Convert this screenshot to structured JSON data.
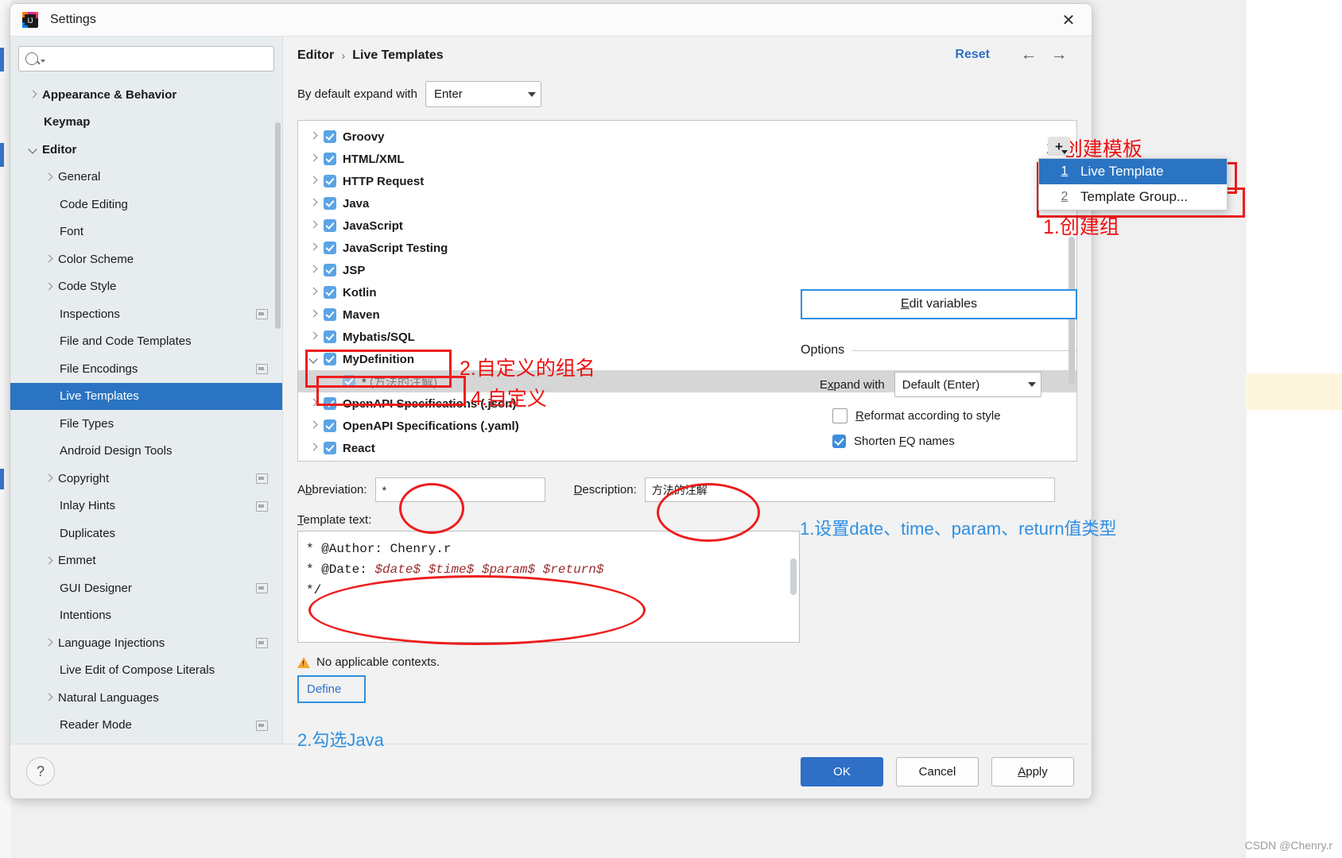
{
  "window": {
    "title": "Settings",
    "app_icon": "intellij-idea-icon",
    "close_label": "✕"
  },
  "sidebar": {
    "search_placeholder": "",
    "search_value": "",
    "items": [
      {
        "label": "Appearance & Behavior",
        "level": 0,
        "arrow": "right",
        "bold": true,
        "badge": false,
        "selected": false
      },
      {
        "label": "Keymap",
        "level": 0,
        "arrow": "none",
        "bold": true,
        "badge": false,
        "selected": false
      },
      {
        "label": "Editor",
        "level": 0,
        "arrow": "down",
        "bold": true,
        "badge": false,
        "selected": false
      },
      {
        "label": "General",
        "level": 1,
        "arrow": "right",
        "bold": false,
        "badge": false,
        "selected": false
      },
      {
        "label": "Code Editing",
        "level": 1,
        "arrow": "none",
        "bold": false,
        "badge": false,
        "selected": false
      },
      {
        "label": "Font",
        "level": 1,
        "arrow": "none",
        "bold": false,
        "badge": false,
        "selected": false
      },
      {
        "label": "Color Scheme",
        "level": 1,
        "arrow": "right",
        "bold": false,
        "badge": false,
        "selected": false
      },
      {
        "label": "Code Style",
        "level": 1,
        "arrow": "right",
        "bold": false,
        "badge": false,
        "selected": false
      },
      {
        "label": "Inspections",
        "level": 1,
        "arrow": "none",
        "bold": false,
        "badge": true,
        "selected": false
      },
      {
        "label": "File and Code Templates",
        "level": 1,
        "arrow": "none",
        "bold": false,
        "badge": false,
        "selected": false
      },
      {
        "label": "File Encodings",
        "level": 1,
        "arrow": "none",
        "bold": false,
        "badge": true,
        "selected": false
      },
      {
        "label": "Live Templates",
        "level": 1,
        "arrow": "none",
        "bold": false,
        "badge": false,
        "selected": true
      },
      {
        "label": "File Types",
        "level": 1,
        "arrow": "none",
        "bold": false,
        "badge": false,
        "selected": false
      },
      {
        "label": "Android Design Tools",
        "level": 1,
        "arrow": "none",
        "bold": false,
        "badge": false,
        "selected": false
      },
      {
        "label": "Copyright",
        "level": 1,
        "arrow": "right",
        "bold": false,
        "badge": true,
        "selected": false
      },
      {
        "label": "Inlay Hints",
        "level": 1,
        "arrow": "none",
        "bold": false,
        "badge": true,
        "selected": false
      },
      {
        "label": "Duplicates",
        "level": 1,
        "arrow": "none",
        "bold": false,
        "badge": false,
        "selected": false
      },
      {
        "label": "Emmet",
        "level": 1,
        "arrow": "right",
        "bold": false,
        "badge": false,
        "selected": false
      },
      {
        "label": "GUI Designer",
        "level": 1,
        "arrow": "none",
        "bold": false,
        "badge": true,
        "selected": false
      },
      {
        "label": "Intentions",
        "level": 1,
        "arrow": "none",
        "bold": false,
        "badge": false,
        "selected": false
      },
      {
        "label": "Language Injections",
        "level": 1,
        "arrow": "right",
        "bold": false,
        "badge": true,
        "selected": false
      },
      {
        "label": "Live Edit of Compose Literals",
        "level": 1,
        "arrow": "none",
        "bold": false,
        "badge": false,
        "selected": false
      },
      {
        "label": "Natural Languages",
        "level": 1,
        "arrow": "right",
        "bold": false,
        "badge": false,
        "selected": false
      },
      {
        "label": "Reader Mode",
        "level": 1,
        "arrow": "none",
        "bold": false,
        "badge": true,
        "selected": false
      }
    ]
  },
  "header": {
    "breadcrumb_parent": "Editor",
    "breadcrumb_sep": "›",
    "breadcrumb_current": "Live Templates",
    "reset_label": "Reset",
    "back_icon": "←",
    "forward_icon": "→"
  },
  "expand_row": {
    "label": "By default expand with",
    "value": "Enter"
  },
  "templates": [
    {
      "label": "Groovy",
      "arrow": "right",
      "child": false,
      "checked": true
    },
    {
      "label": "HTML/XML",
      "arrow": "right",
      "child": false,
      "checked": true
    },
    {
      "label": "HTTP Request",
      "arrow": "right",
      "child": false,
      "checked": true
    },
    {
      "label": "Java",
      "arrow": "right",
      "child": false,
      "checked": true
    },
    {
      "label": "JavaScript",
      "arrow": "right",
      "child": false,
      "checked": true
    },
    {
      "label": "JavaScript Testing",
      "arrow": "right",
      "child": false,
      "checked": true
    },
    {
      "label": "JSP",
      "arrow": "right",
      "child": false,
      "checked": true
    },
    {
      "label": "Kotlin",
      "arrow": "right",
      "child": false,
      "checked": true
    },
    {
      "label": "Maven",
      "arrow": "right",
      "child": false,
      "checked": true
    },
    {
      "label": "Mybatis/SQL",
      "arrow": "right",
      "child": false,
      "checked": true
    },
    {
      "label": "MyDefinition",
      "arrow": "down",
      "child": false,
      "checked": true
    },
    {
      "label": "*",
      "label_suffix": "(方法的注解)",
      "arrow": "none",
      "child": true,
      "checked": true
    },
    {
      "label": "OpenAPI Specifications (.json)",
      "arrow": "right",
      "child": false,
      "checked": true
    },
    {
      "label": "OpenAPI Specifications (.yaml)",
      "arrow": "right",
      "child": false,
      "checked": true
    },
    {
      "label": "React",
      "arrow": "right",
      "child": false,
      "checked": true
    }
  ],
  "add_menu": {
    "plus_icon": "plus-icon",
    "items": [
      {
        "num": "1",
        "label": "Live Template",
        "selected": true
      },
      {
        "num": "2",
        "label": "Template Group...",
        "selected": false
      }
    ]
  },
  "form": {
    "abbreviation_label": "Abbreviation:",
    "abbreviation_value": "*",
    "description_label": "Description:",
    "description_value": "方法的注解",
    "template_text_label": "Template text:",
    "template_lines": [
      {
        "prefix": " * @Author: Chenry.r",
        "vars": ""
      },
      {
        "prefix": " * @Date: ",
        "vars": "$date$ $time$ $param$ $return$"
      },
      {
        "prefix": " */",
        "vars": ""
      }
    ],
    "context_warning": "No applicable contexts.",
    "define_label": "Define"
  },
  "options": {
    "edit_variables_label": "Edit variables",
    "section_title": "Options",
    "expand_with_label": "Expand with",
    "expand_with_value": "Default (Enter)",
    "reformat_label": "Reformat according to style",
    "reformat_checked": false,
    "shorten_label": "Shorten FQ names",
    "shorten_checked": true
  },
  "footer": {
    "help_label": "?",
    "ok_label": "OK",
    "cancel_label": "Cancel",
    "apply_label": "Apply"
  },
  "annotations": [
    {
      "id": "a1",
      "text": "3.创建模板",
      "color": "#ee1111"
    },
    {
      "id": "a2",
      "text": "1.创建组",
      "color": "#ee1111"
    },
    {
      "id": "a3",
      "text": "2.自定义的组名",
      "color": "#ee1111"
    },
    {
      "id": "a4",
      "text": "4.自定义",
      "color": "#ee1111"
    },
    {
      "id": "a5",
      "text": "1.设置date、time、param、return值类型",
      "color": "#2f8fe0"
    },
    {
      "id": "a6",
      "text": "2.勾选Java",
      "color": "#2f8fe0"
    }
  ],
  "watermark": "CSDN @Chenry.r"
}
